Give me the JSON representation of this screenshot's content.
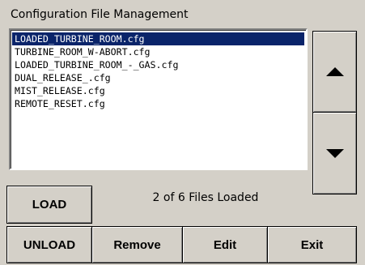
{
  "window": {
    "title": "Configuration File Management"
  },
  "file_list": {
    "selected_index": 0,
    "items": [
      {
        "name": "LOADED_TURBINE_ROOM.cfg"
      },
      {
        "name": "TURBINE_ROOM_W-ABORT.cfg"
      },
      {
        "name": "LOADED_TURBINE_ROOM_-_GAS.cfg"
      },
      {
        "name": "DUAL_RELEASE_.cfg"
      },
      {
        "name": "MIST_RELEASE.cfg"
      },
      {
        "name": "REMOTE_RESET.cfg"
      }
    ]
  },
  "scroll": {
    "up_icon": "triangle-up-icon",
    "down_icon": "triangle-down-icon"
  },
  "status": {
    "text": "2 of 6 Files Loaded"
  },
  "buttons": {
    "load": "LOAD",
    "unload": "UNLOAD",
    "remove": "Remove",
    "edit": "Edit",
    "exit": "Exit"
  },
  "colors": {
    "background": "#d4d0c8",
    "selection": "#0a246a",
    "selection_text": "#ffffff"
  }
}
